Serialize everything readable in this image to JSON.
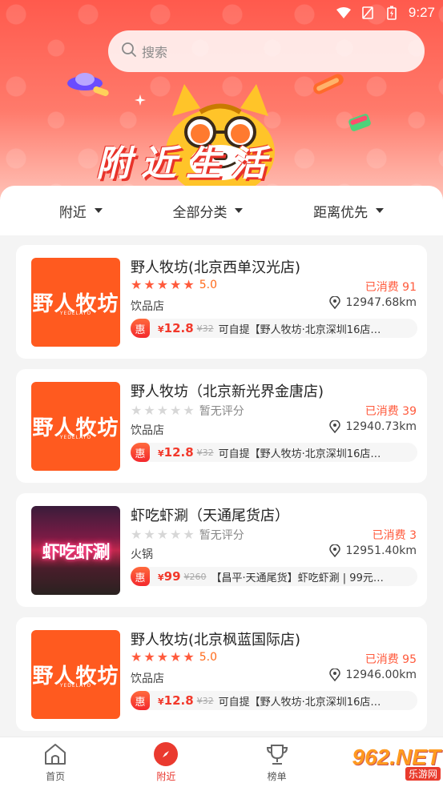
{
  "status_bar": {
    "time": "9:27"
  },
  "search": {
    "placeholder": "搜索"
  },
  "banner": {
    "title": "附近生活"
  },
  "filters": [
    {
      "label": "附近"
    },
    {
      "label": "全部分类"
    },
    {
      "label": "距离优先"
    }
  ],
  "stores": [
    {
      "name": "野人牧坊(北京西单汉光店)",
      "rating_stars": 5,
      "rating_text": "5.0",
      "sold": "已消费  91",
      "category": "饮品店",
      "distance": "12947.68km",
      "deal_badge": "惠",
      "price_symbol": "¥",
      "price": "12.8",
      "original_price": "¥32",
      "deal_desc": "可自提【野人牧坊·北京深圳16店…",
      "thumb_logo": "野人牧坊",
      "thumb_sub": "YEDELATO"
    },
    {
      "name": "野人牧坊（北京新光界金唐店)",
      "rating_stars": 0,
      "rating_text": "暂无评分",
      "sold": "已消费  39",
      "category": "饮品店",
      "distance": "12940.73km",
      "deal_badge": "惠",
      "price_symbol": "¥",
      "price": "12.8",
      "original_price": "¥32",
      "deal_desc": "可自提【野人牧坊·北京深圳16店…",
      "thumb_logo": "野人牧坊",
      "thumb_sub": "YEDELATO"
    },
    {
      "name": "虾吃虾涮（天通尾货店）",
      "rating_stars": 0,
      "rating_text": "暂无评分",
      "sold": "已消费  3",
      "category": "火锅",
      "distance": "12951.40km",
      "deal_badge": "惠",
      "price_symbol": "¥",
      "price": "99",
      "original_price": "¥260",
      "deal_desc": "【昌平·天通尾货】虾吃虾涮 | 99元…",
      "thumb_logo": "虾吃虾涮"
    },
    {
      "name": "野人牧坊(北京枫蓝国际店)",
      "rating_stars": 5,
      "rating_text": "5.0",
      "sold": "已消费  95",
      "category": "饮品店",
      "distance": "12946.00km",
      "deal_badge": "惠",
      "price_symbol": "¥",
      "price": "12.8",
      "original_price": "¥32",
      "deal_desc": "可自提【野人牧坊·北京深圳16店…",
      "thumb_logo": "野人牧坊",
      "thumb_sub": "YEDELATO"
    }
  ],
  "bottom_nav": [
    {
      "label": "首页",
      "icon": "home-icon"
    },
    {
      "label": "附近",
      "icon": "compass-icon",
      "active": true
    },
    {
      "label": "榜单",
      "icon": "trophy-icon"
    }
  ],
  "watermark": {
    "big": "962.NET",
    "small": "乐游网"
  },
  "colors": {
    "accent": "#e8332a",
    "price": "#f2382a",
    "star": "#ff5a3c",
    "thumb_bg": "#ff5a1f"
  }
}
